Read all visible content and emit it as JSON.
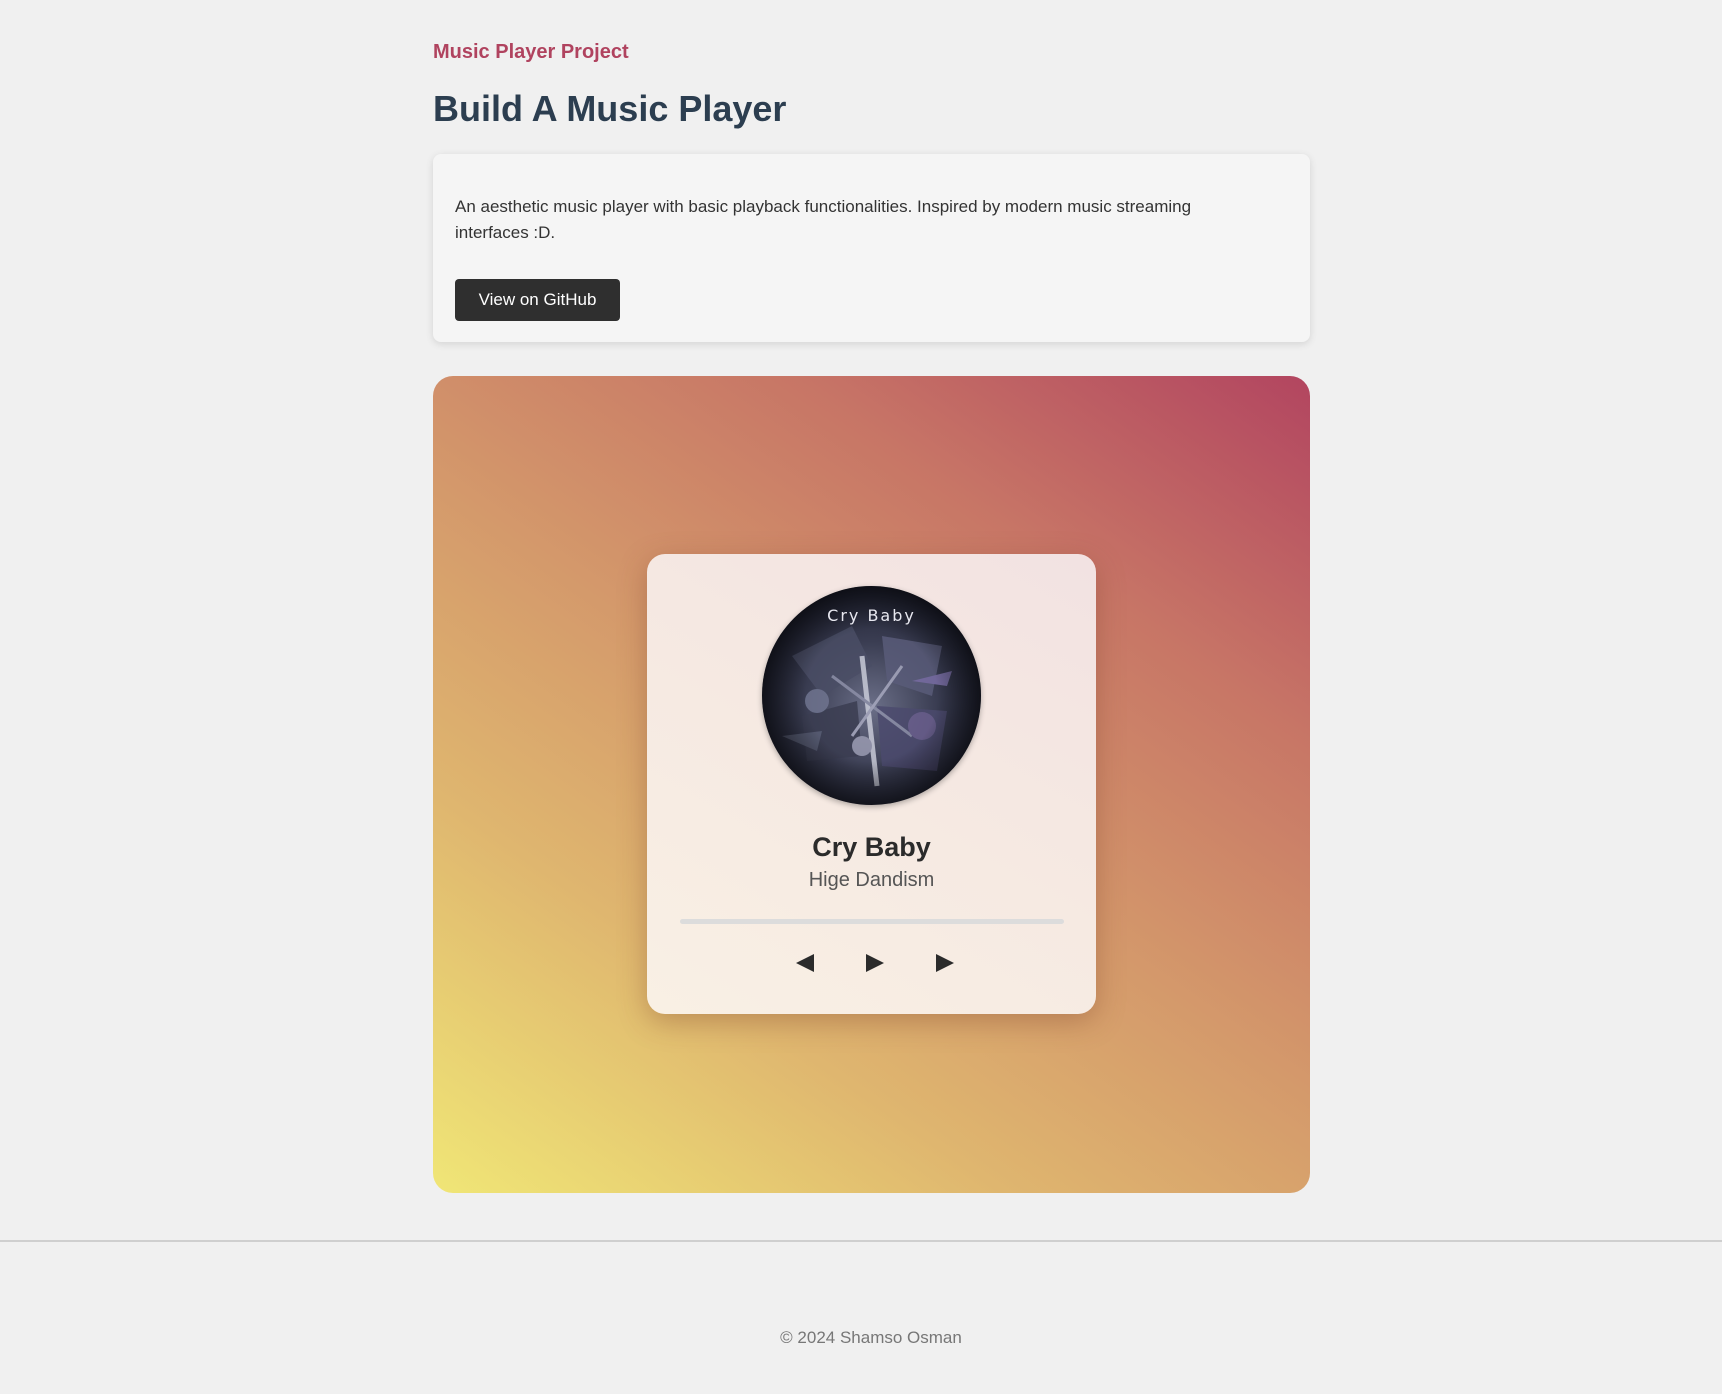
{
  "header": {
    "eyebrow": "Music Player Project",
    "title": "Build A Music Player"
  },
  "info": {
    "description": "An aesthetic music player with basic playback functionalities. Inspired by modern music streaming interfaces :D.",
    "github_label": "View on GitHub"
  },
  "player": {
    "album_art_text": "Cry Baby",
    "song_title": "Cry Baby",
    "artist": "Hige Dandism",
    "progress": 0,
    "controls": {
      "prev_icon": "previous-triangle-icon",
      "play_icon": "play-triangle-icon",
      "next_icon": "next-triangle-icon"
    }
  },
  "footer": {
    "copyright": "© 2024 Shamso Osman"
  },
  "colors": {
    "accent": "#b0435f",
    "title": "#2c3e50",
    "button_bg": "#2f2f2f",
    "gradient_start": "#f0e676",
    "gradient_end": "#b24560"
  }
}
